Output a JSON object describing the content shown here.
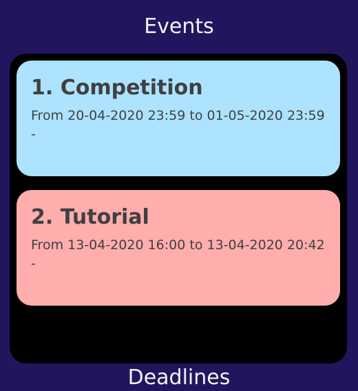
{
  "panel": {
    "title": "Events"
  },
  "events": [
    {
      "title": "1. Competition",
      "range": "From 20-04-2020 23:59 to 01-05-2020 23:59",
      "description": "-",
      "color": "#ade3ff"
    },
    {
      "title": "2. Tutorial",
      "range": "From 13-04-2020 16:00 to 13-04-2020 20:42",
      "description": "-",
      "color": "#ffadad"
    }
  ],
  "next_panel": {
    "title": "Deadlines"
  }
}
